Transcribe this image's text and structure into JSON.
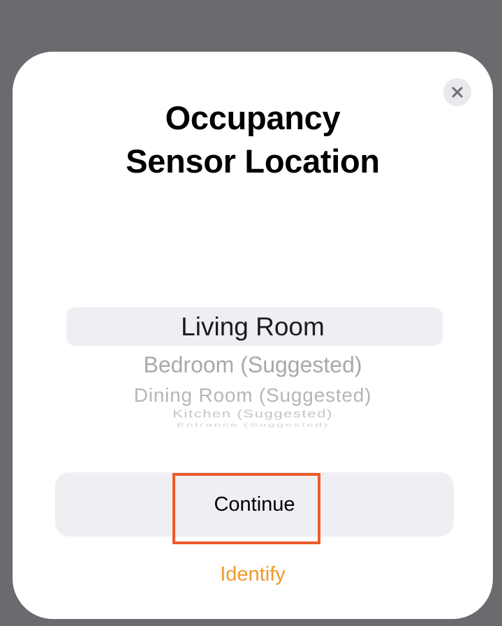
{
  "dialog": {
    "title_line1": "Occupancy",
    "title_line2": "Sensor Location",
    "close_icon": "close-icon"
  },
  "location_picker": {
    "selected": "Living Room",
    "options": [
      "Living Room",
      "Bedroom (Suggested)",
      "Dining Room (Suggested)",
      "Kitchen (Suggested)",
      "Entrance (Suggested)"
    ]
  },
  "actions": {
    "continue_label": "Continue",
    "identify_label": "Identify"
  },
  "colors": {
    "accent": "#f0982e",
    "highlight_outline": "#ee5a2a",
    "button_background": "#efeff3",
    "backdrop": "#6b6b6f"
  }
}
